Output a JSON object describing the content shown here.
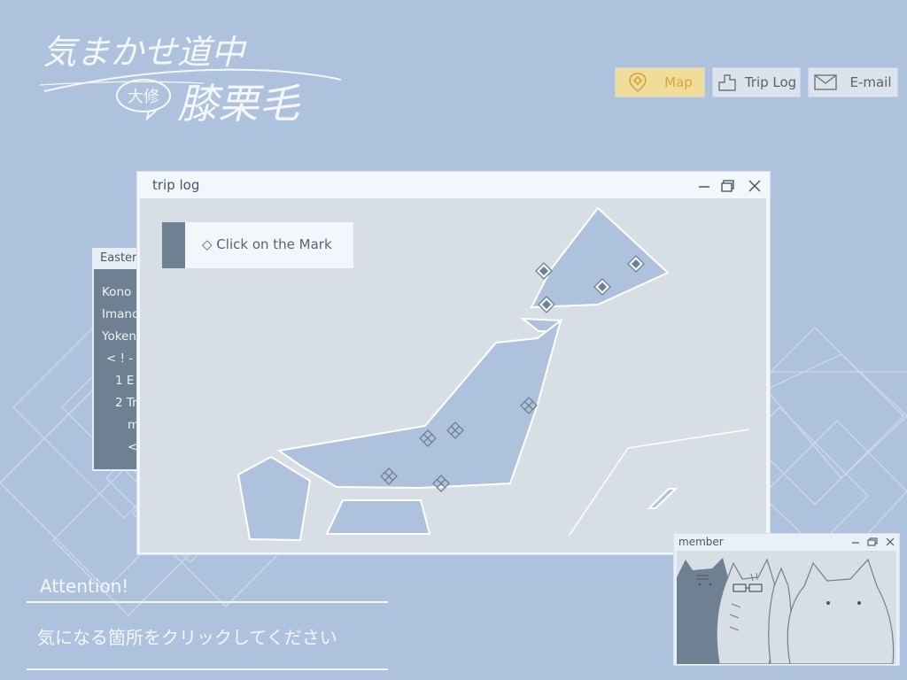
{
  "logo": {
    "line1": "気まかせ道中",
    "bubble": "大修",
    "line2": "膝栗毛"
  },
  "nav": {
    "map": "Map",
    "trip": "Trip Log",
    "email": "E-mail"
  },
  "back_window": {
    "title": "Easter",
    "lines": [
      "Kono",
      "Imanc",
      "Yoken",
      "< ! -",
      "1 E",
      "2 Tr",
      "m",
      "<"
    ]
  },
  "main_window": {
    "title": "trip log",
    "hint": "◇ Click on the Mark"
  },
  "member_window": {
    "title": "member"
  },
  "attention": {
    "title": "Attention!",
    "text": "気になる箇所をクリックしてください"
  },
  "colors": {
    "background": "#aec2de",
    "map_land": "#aec2de",
    "map_sea": "#d8dee6",
    "map_button_bg": "#f0dd9a",
    "map_button_text": "#d4a53c",
    "marker": "#6f8092"
  },
  "icons": {
    "map": "map-pin-icon",
    "trip": "notebook-icon",
    "email": "envelope-icon",
    "minimize": "minimize-icon",
    "maximize": "maximize-icon",
    "close": "close-icon"
  }
}
